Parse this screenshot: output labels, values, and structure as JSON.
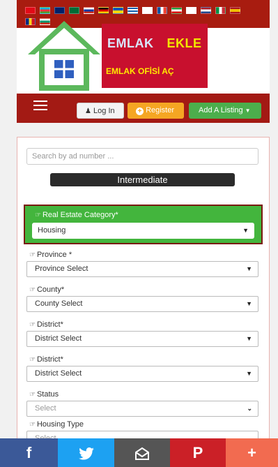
{
  "colors": {
    "header_red": "#a81c10",
    "brand_red": "#c8102e",
    "brand_yellow": "#f2e600",
    "green": "#43b53d",
    "facebook": "#3b5998",
    "twitter": "#1da1f2",
    "email": "#555555",
    "pinterest": "#cb2027",
    "more": "#f26b50"
  },
  "brand": {
    "line1_a": "EMLAK",
    "line1_b": "EKLE",
    "line2": "EMLAK OFİSİ AÇ"
  },
  "navbar": {
    "menu_icon": "hamburger-icon",
    "login_label": "Log In",
    "register_label": "Register",
    "add_listing_label": "Add A Listing"
  },
  "form": {
    "search_placeholder": "Search by ad number ...",
    "intermediate_label": "Intermediate",
    "category": {
      "label": "Real Estate Category*",
      "value": "Housing"
    },
    "fields": [
      {
        "label": "Province *",
        "value": "Province Select"
      },
      {
        "label": "County*",
        "value": "County Select"
      },
      {
        "label": "District*",
        "value": "District Select"
      },
      {
        "label": "District*",
        "value": "District Select"
      },
      {
        "label": "Status",
        "value": "Select"
      },
      {
        "label": "Housing Type",
        "value": "Select"
      }
    ]
  },
  "share": {
    "facebook": "f",
    "twitter": "twitter-bird-icon",
    "email": "email-icon",
    "pinterest": "P",
    "more": "+"
  }
}
